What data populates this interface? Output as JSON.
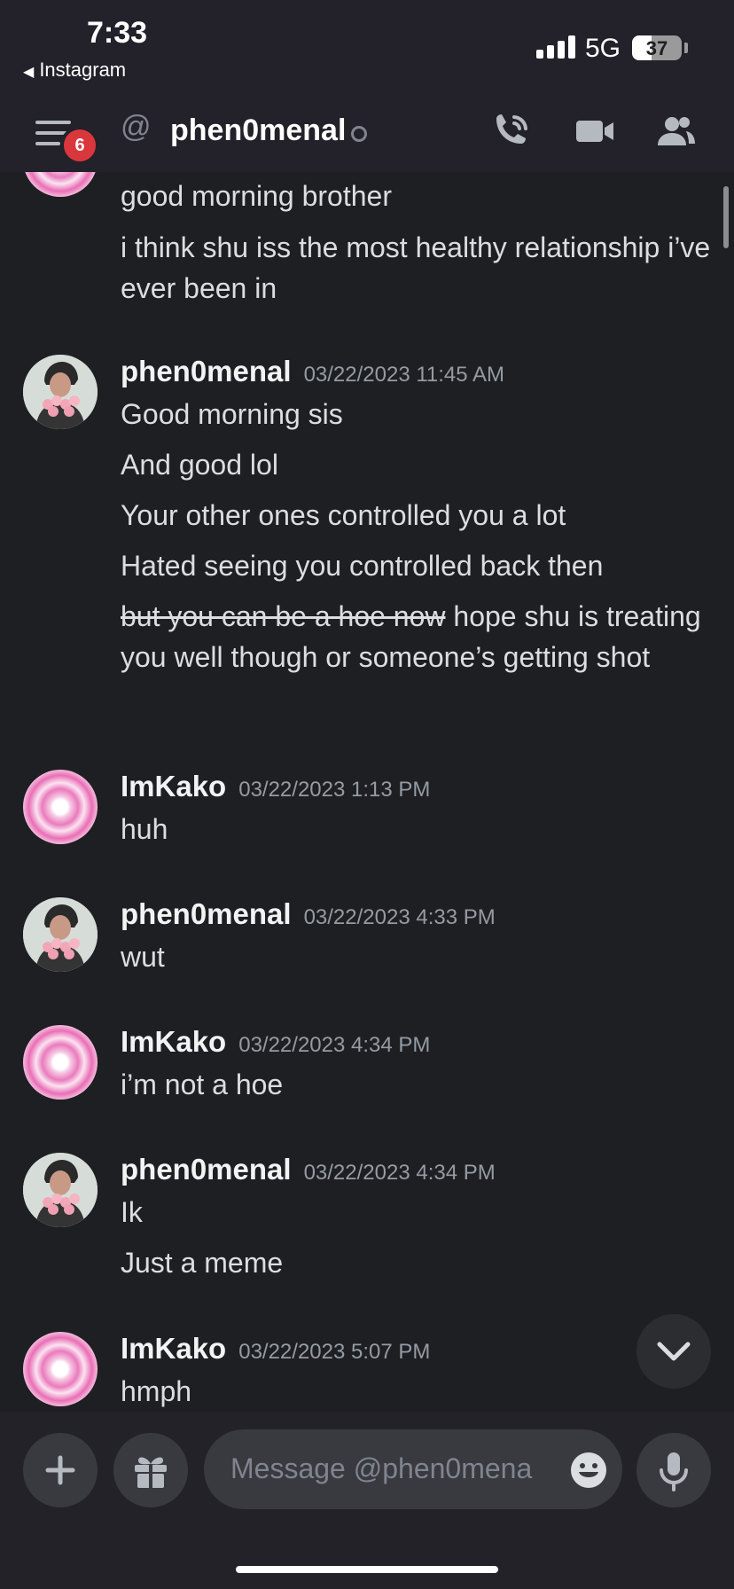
{
  "status_bar": {
    "time": "7:33",
    "back_app": "Instagram",
    "network": "5G",
    "battery": "37"
  },
  "header": {
    "unread_count": "6",
    "at_symbol": "@",
    "dm_name": "phen0menal"
  },
  "messages": {
    "continuation": [
      "good morning brother",
      "i think shu iss the most healthy relationship i’ve ever been in"
    ],
    "groups": [
      {
        "author": "phen0menal",
        "timestamp": "03/22/2023 11:45 AM",
        "lines": [
          "Good morning sis",
          "And good lol",
          "Your other ones controlled you a lot",
          "Hated seeing you controlled back then"
        ],
        "last_line_struck": "but you can be a hoe now",
        "last_line_rest": " hope shu is treating you well though or someone’s getting shot"
      },
      {
        "author": "ImKako",
        "timestamp": "03/22/2023 1:13 PM",
        "lines": [
          "huh"
        ]
      },
      {
        "author": "phen0menal",
        "timestamp": "03/22/2023 4:33 PM",
        "lines": [
          "wut"
        ]
      },
      {
        "author": "ImKako",
        "timestamp": "03/22/2023 4:34 PM",
        "lines": [
          "i’m not a hoe"
        ]
      },
      {
        "author": "phen0menal",
        "timestamp": "03/22/2023 4:34 PM",
        "lines": [
          "Ik",
          "Just a meme"
        ]
      },
      {
        "author": "ImKako",
        "timestamp": "03/22/2023 5:07 PM",
        "lines": [
          "hmph"
        ]
      }
    ]
  },
  "composer": {
    "placeholder": "Message @phen0mena"
  },
  "colors": {
    "background": "#1e1f22",
    "header": "#232129",
    "badge": "#da373c",
    "input": "#383a40"
  },
  "icons": [
    "menu-icon",
    "phone-call-icon",
    "video-camera-icon",
    "members-icon",
    "chevron-down-icon",
    "plus-icon",
    "gift-icon",
    "emoji-icon",
    "microphone-icon"
  ]
}
